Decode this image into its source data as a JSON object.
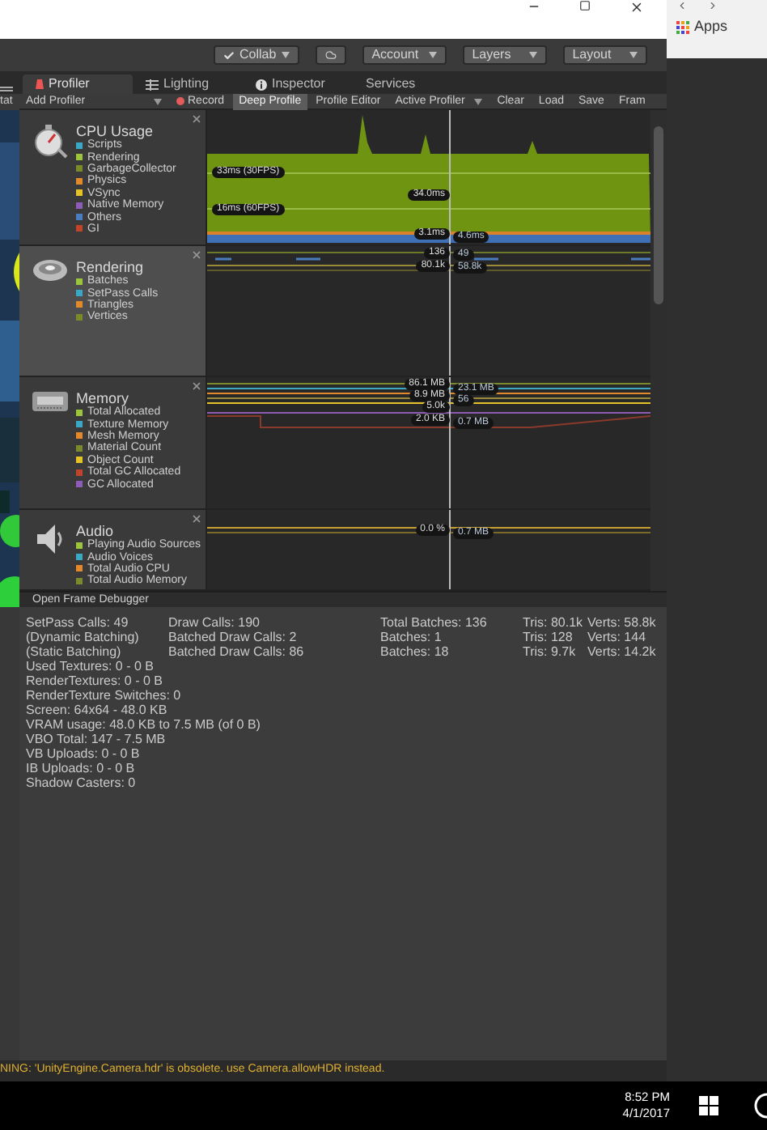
{
  "browser": {
    "bookmark": "Apps"
  },
  "toolbar": {
    "buttons": [
      {
        "kind": "collab",
        "label": "Collab"
      },
      {
        "kind": "cloud"
      },
      {
        "kind": "dropdown",
        "label": "Account"
      },
      {
        "kind": "dropdown",
        "label": "Layers"
      },
      {
        "kind": "dropdown",
        "label": "Layout"
      }
    ]
  },
  "scene_fragment": {
    "label": "tat"
  },
  "tabs": [
    {
      "label": "Profiler",
      "selected": true
    },
    {
      "label": "Lighting",
      "selected": false
    },
    {
      "label": "Inspector",
      "selected": false
    },
    {
      "label": "Services",
      "selected": false
    }
  ],
  "profiler_toolbar": [
    {
      "kind": "dropdown",
      "label": "Add Profiler"
    },
    {
      "kind": "record",
      "label": "Record",
      "selected": false
    },
    {
      "kind": "toggle",
      "label": "Deep Profile",
      "selected": true
    },
    {
      "kind": "toggle",
      "label": "Profile Editor",
      "selected": false
    },
    {
      "kind": "dropdown",
      "label": "Active Profiler"
    },
    {
      "kind": "button",
      "label": "Clear"
    },
    {
      "kind": "button",
      "label": "Load"
    },
    {
      "kind": "button",
      "label": "Save"
    },
    {
      "kind": "button",
      "label": "Fram"
    }
  ],
  "modules": [
    {
      "kind": "cpu",
      "title": "CPU Usage",
      "selected": false,
      "legend": [
        {
          "label": "Scripts",
          "color": "#3aa7c4"
        },
        {
          "label": "Rendering",
          "color": "#9bc53d"
        },
        {
          "label": "GarbageCollector",
          "color": "#7d8a2c"
        },
        {
          "label": "Physics",
          "color": "#e28a2b"
        },
        {
          "label": "VSync",
          "color": "#e6c229"
        },
        {
          "label": "Native Memory",
          "color": "#8e5bb5"
        },
        {
          "label": "Others",
          "color": "#4a7cc0"
        },
        {
          "label": "GI",
          "color": "#c0452b"
        }
      ],
      "chart_labels": [
        {
          "text": "33ms (30FPS)",
          "kind": "threshold"
        },
        {
          "text": "16ms (60FPS)",
          "kind": "threshold"
        },
        {
          "text": "34.0ms",
          "kind": "before"
        },
        {
          "text": "3.1ms",
          "kind": "before"
        },
        {
          "text": "4.6ms",
          "kind": "after"
        }
      ]
    },
    {
      "kind": "rendering",
      "title": "Rendering",
      "selected": true,
      "legend": [
        {
          "label": "Batches",
          "color": "#9bc53d"
        },
        {
          "label": "SetPass Calls",
          "color": "#3aa7c4"
        },
        {
          "label": "Triangles",
          "color": "#e28a2b"
        },
        {
          "label": "Vertices",
          "color": "#7d8a2c"
        }
      ],
      "chart_labels": [
        {
          "text": "136",
          "kind": "before"
        },
        {
          "text": "49",
          "kind": "after"
        },
        {
          "text": "80.1k",
          "kind": "before"
        },
        {
          "text": "58.8k",
          "kind": "after"
        }
      ]
    },
    {
      "kind": "memory",
      "title": "Memory",
      "selected": false,
      "legend": [
        {
          "label": "Total Allocated",
          "color": "#9bc53d"
        },
        {
          "label": "Texture Memory",
          "color": "#3aa7c4"
        },
        {
          "label": "Mesh Memory",
          "color": "#e28a2b"
        },
        {
          "label": "Material Count",
          "color": "#7d8a2c"
        },
        {
          "label": "Object Count",
          "color": "#e6c229"
        },
        {
          "label": "Total GC Allocated",
          "color": "#c0452b"
        },
        {
          "label": "GC Allocated",
          "color": "#8e5bb5"
        }
      ],
      "chart_labels": [
        {
          "text": "86.1 MB",
          "kind": "before"
        },
        {
          "text": "23.1 MB",
          "kind": "after"
        },
        {
          "text": "8.9 MB",
          "kind": "before"
        },
        {
          "text": "56",
          "kind": "after"
        },
        {
          "text": "5.0k",
          "kind": "before"
        },
        {
          "text": "2.0 KB",
          "kind": "before"
        },
        {
          "text": "0.7 MB",
          "kind": "after"
        }
      ]
    },
    {
      "kind": "audio",
      "title": "Audio",
      "selected": false,
      "legend": [
        {
          "label": "Playing Audio Sources",
          "color": "#9bc53d"
        },
        {
          "label": "Audio Voices",
          "color": "#3aa7c4"
        },
        {
          "label": "Total Audio CPU",
          "color": "#e28a2b"
        },
        {
          "label": "Total Audio Memory",
          "color": "#7d8a2c"
        }
      ],
      "chart_labels": [
        {
          "text": "0.0 %",
          "kind": "before"
        },
        {
          "text": "0.7 MB",
          "kind": "after"
        }
      ]
    }
  ],
  "frame_debugger_button": "Open Frame Debugger",
  "stats": {
    "table": [
      [
        "SetPass Calls: 49",
        "Draw Calls: 190",
        "Total Batches: 136",
        "Tris: 80.1k",
        "Verts: 58.8k"
      ],
      [
        "(Dynamic Batching)",
        "Batched Draw Calls: 2",
        "Batches: 1",
        "Tris: 128",
        "Verts: 144"
      ],
      [
        "(Static Batching)",
        "Batched Draw Calls: 86",
        "Batches: 18",
        "Tris: 9.7k",
        "Verts: 14.2k"
      ]
    ],
    "lines": [
      "Used Textures: 0 - 0 B",
      "RenderTextures: 0 - 0 B",
      "RenderTexture Switches: 0",
      "Screen: 64x64 - 48.0 KB",
      "VRAM usage: 48.0 KB to 7.5 MB (of 0 B)",
      "VBO Total: 147 - 7.5 MB",
      "VB Uploads: 0 - 0 B",
      "IB Uploads: 0 - 0 B",
      "Shadow Casters: 0"
    ]
  },
  "console": "NING: 'UnityEngine.Camera.hdr' is obsolete. use Camera.allowHDR instead.",
  "taskbar": {
    "time": "8:52 PM",
    "date": "4/1/2017"
  }
}
